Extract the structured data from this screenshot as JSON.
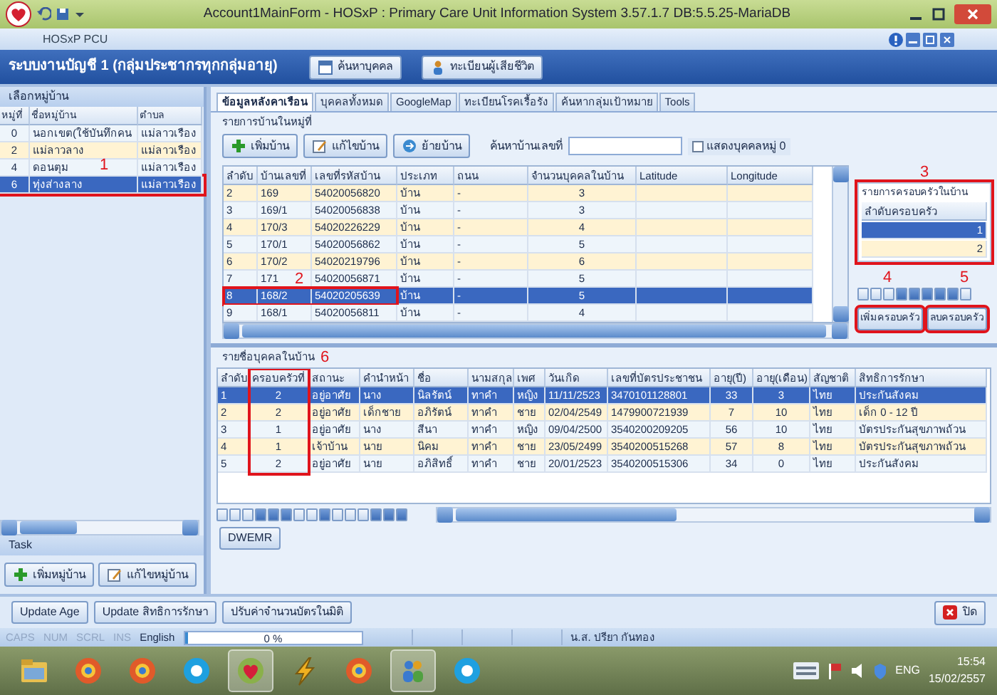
{
  "window": {
    "title": "Account1MainForm -  HOSxP : Primary Care Unit Information System 3.57.1.7 DB:5.5.25-MariaDB"
  },
  "app_label": "HOSxP PCU",
  "module": {
    "title": "ระบบงานบัญชี 1 (กลุ่มประชากรทุกกลุ่มอายุ)",
    "buttons": [
      "ค้นหาบุคคล",
      "ทะเบียนผู้เสียชีวิต"
    ]
  },
  "villages": {
    "heading": "เลือกหมู่บ้าน",
    "annotation": "1",
    "columns": [
      "หมู่ที่",
      "ชื่อหมู่บ้าน",
      "ตำบล"
    ],
    "rows": [
      {
        "cells": [
          "0",
          "นอกเขต(ใช้บันทึกคน",
          "แม่ลาวเรือง"
        ],
        "selected": false,
        "boxed": false
      },
      {
        "cells": [
          "2",
          "แม่ลาวลาง",
          "แม่ลาวเรือง"
        ],
        "selected": false,
        "boxed": false
      },
      {
        "cells": [
          "4",
          "ดอนตุม",
          "แม่ลาวเรือง"
        ],
        "selected": false,
        "boxed": false
      },
      {
        "cells": [
          "6",
          "ทุ่งส่างลาง",
          "แม่ลาวเรือง"
        ],
        "selected": true,
        "boxed": true
      }
    ]
  },
  "task": {
    "heading": "Task",
    "buttons": [
      "เพิ่มหมู่บ้าน",
      "แก้ไขหมู่บ้าน"
    ]
  },
  "tabs": [
    {
      "label": "ข้อมูลหลังคาเรือน",
      "selected": true
    },
    {
      "label": "บุคคลทั้งหมด",
      "selected": false
    },
    {
      "label": "GoogleMap",
      "selected": false
    },
    {
      "label": "ทะเบียนโรคเรื้อรัง",
      "selected": false
    },
    {
      "label": "ค้นหากลุ่มเป้าหมาย",
      "selected": false
    },
    {
      "label": "Tools",
      "selected": false
    }
  ],
  "houses": {
    "heading": "รายการบ้านในหมู่ที่",
    "annotation": "2",
    "toolbar": [
      "เพิ่มบ้าน",
      "แก้ไขบ้าน",
      "ย้ายบ้าน"
    ],
    "search_label": "ค้นหาบ้านเลขที่",
    "show_all": {
      "label": "แสดงบุคคลหมู่ 0",
      "checked": false
    },
    "columns": [
      "ลำดับ",
      "บ้านเลขที่",
      "เลขที่รหัสบ้าน",
      "ประเภท",
      "ถนน",
      "จำนวนบุคคลในบ้าน",
      "Latitude",
      "Longitude"
    ],
    "rows": [
      {
        "cells": [
          "2",
          "169",
          "54020056820",
          "บ้าน",
          "-",
          "3"
        ],
        "selected": false,
        "boxed": false
      },
      {
        "cells": [
          "3",
          "169/1",
          "54020056838",
          "บ้าน",
          "-",
          "3"
        ],
        "selected": false,
        "boxed": false
      },
      {
        "cells": [
          "4",
          "170/3",
          "54020226229",
          "บ้าน",
          "-",
          "4"
        ],
        "selected": false,
        "boxed": false
      },
      {
        "cells": [
          "5",
          "170/1",
          "54020056862",
          "บ้าน",
          "-",
          "5"
        ],
        "selected": false,
        "boxed": false
      },
      {
        "cells": [
          "6",
          "170/2",
          "54020219796",
          "บ้าน",
          "-",
          "6"
        ],
        "selected": false,
        "boxed": false
      },
      {
        "cells": [
          "7",
          "171",
          "54020056871",
          "บ้าน",
          "-",
          "5"
        ],
        "selected": false,
        "boxed": false
      },
      {
        "cells": [
          "8",
          "168/2",
          "54020205639",
          "บ้าน",
          "-",
          "5"
        ],
        "selected": true,
        "boxed": true
      },
      {
        "cells": [
          "9",
          "168/1",
          "54020056811",
          "บ้าน",
          "-",
          "4"
        ],
        "selected": false,
        "boxed": false
      }
    ]
  },
  "families": {
    "heading": "รายการครอบครัวในบ้าน",
    "annotation": "3",
    "boxed": true,
    "columns": [
      "ลำดับครอบครัว"
    ],
    "rows": [
      {
        "cells": [
          "1"
        ],
        "selected": true
      },
      {
        "cells": [
          "2"
        ],
        "selected": false
      }
    ],
    "pager_annotations": [
      "4",
      "5"
    ],
    "buttons": [
      {
        "label": "เพิ่มครอบครัว",
        "boxed": true
      },
      {
        "label": "ลบครอบครัว",
        "boxed": true
      }
    ]
  },
  "persons": {
    "heading": "รายชื่อบุคคลในบ้าน",
    "annotation": "6",
    "columns": [
      {
        "label": "ลำดับ",
        "boxed": false
      },
      {
        "label": "ครอบครัวที่",
        "boxed": true
      },
      {
        "label": "สถานะ",
        "boxed": false
      },
      {
        "label": "คำนำหน้า",
        "boxed": false
      },
      {
        "label": "ชื่อ",
        "boxed": false
      },
      {
        "label": "นามสกุล",
        "boxed": false
      },
      {
        "label": "เพศ",
        "boxed": false
      },
      {
        "label": "วันเกิด",
        "boxed": false
      },
      {
        "label": "เลขที่บัตรประชาชน",
        "boxed": false
      },
      {
        "label": "อายุ(ปี)",
        "boxed": false
      },
      {
        "label": "อายุ(เดือน)",
        "boxed": false
      },
      {
        "label": "สัญชาติ",
        "boxed": false
      },
      {
        "label": "สิทธิการรักษา",
        "boxed": false
      }
    ],
    "rows": [
      {
        "cells": [
          "1",
          "2",
          "อยู่อาศัย",
          "นาง",
          "นิลรัตน์",
          "ทาคำ",
          "หญิง",
          "11/11/2523",
          "3470101128801",
          "33",
          "3",
          "ไทย",
          "ประกันสังคม"
        ],
        "selected": true
      },
      {
        "cells": [
          "2",
          "2",
          "อยู่อาศัย",
          "เด็กชาย",
          "อภิรัตน์",
          "ทาคำ",
          "ชาย",
          "02/04/2549",
          "1479900721939",
          "7",
          "10",
          "ไทย",
          "เด็ก 0 - 12 ปี"
        ],
        "selected": false
      },
      {
        "cells": [
          "3",
          "1",
          "อยู่อาศัย",
          "นาง",
          "สีนา",
          "ทาคำ",
          "หญิง",
          "09/04/2500",
          "3540200209205",
          "56",
          "10",
          "ไทย",
          "บัตรประกันสุขภาพถ้วน"
        ],
        "selected": false
      },
      {
        "cells": [
          "4",
          "1",
          "เจ้าบ้าน",
          "นาย",
          "นิคม",
          "ทาคำ",
          "ชาย",
          "23/05/2499",
          "3540200515268",
          "57",
          "8",
          "ไทย",
          "บัตรประกันสุขภาพถ้วน"
        ],
        "selected": false
      },
      {
        "cells": [
          "5",
          "2",
          "อยู่อาศัย",
          "นาย",
          "อภิสิทธิ์",
          "ทาคำ",
          "ชาย",
          "20/01/2523",
          "3540200515306",
          "34",
          "0",
          "ไทย",
          "ประกันสังคม"
        ],
        "selected": false
      }
    ]
  },
  "dwemr": "DWEMR",
  "footer": {
    "buttons": [
      "Update Age",
      "Update สิทธิการรักษา",
      "ปรับค่าจำนวนบัตรในมิติ"
    ],
    "close": "ปิด"
  },
  "status_bar": {
    "keys": [
      {
        "label": "CAPS",
        "on": false
      },
      {
        "label": "NUM",
        "on": false
      },
      {
        "label": "SCRL",
        "on": false
      },
      {
        "label": "INS",
        "on": false
      }
    ],
    "language": "English",
    "progress": {
      "level": 0,
      "reading": "0 %"
    },
    "user": "น.ส. ปรียา กันทอง"
  },
  "taskbar": {
    "apps": [
      {
        "kind": "folder",
        "active": false
      },
      {
        "kind": "globe",
        "active": false
      },
      {
        "kind": "globe",
        "active": false
      },
      {
        "kind": "chat",
        "active": false
      },
      {
        "kind": "heart",
        "active": true
      },
      {
        "kind": "bolt",
        "active": false
      },
      {
        "kind": "globe",
        "active": false
      },
      {
        "kind": "people",
        "active": true
      },
      {
        "kind": "chat",
        "active": false
      }
    ],
    "language": "ENG",
    "time": "15:54",
    "date": "15/02/2557"
  }
}
